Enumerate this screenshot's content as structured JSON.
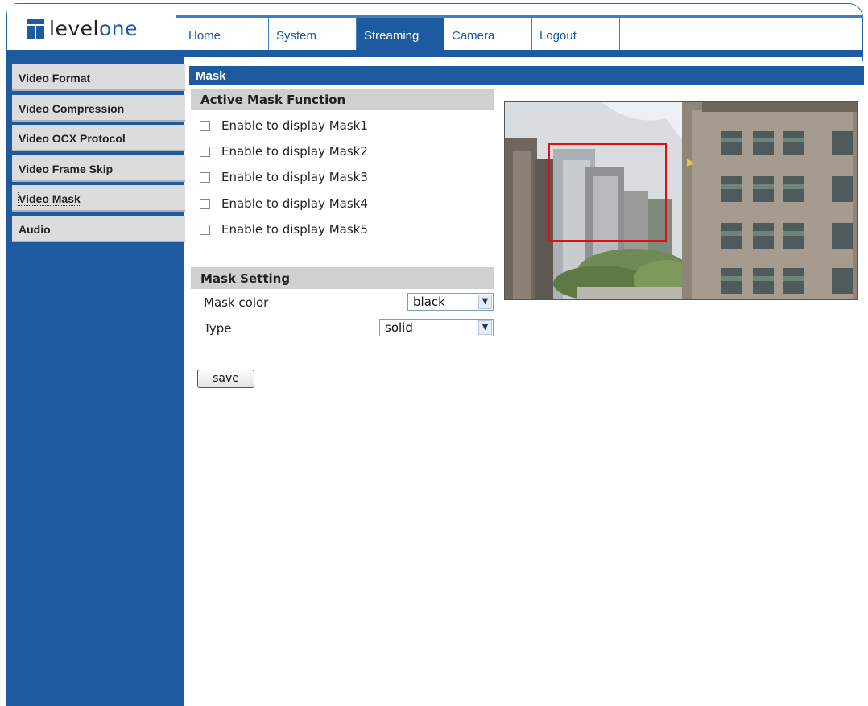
{
  "brand": {
    "logo_text_main": "level",
    "logo_text_accent": "one"
  },
  "tabs": [
    {
      "label": "Home"
    },
    {
      "label": "System"
    },
    {
      "label": "Streaming",
      "active": true
    },
    {
      "label": "Camera"
    },
    {
      "label": "Logout"
    }
  ],
  "sidebar": {
    "items": [
      {
        "label": "Video Format"
      },
      {
        "label": "Video Compression"
      },
      {
        "label": "Video OCX Protocol"
      },
      {
        "label": "Video Frame Skip"
      },
      {
        "label": "Video Mask",
        "active": true
      },
      {
        "label": "Audio"
      }
    ]
  },
  "page": {
    "title": "Mask"
  },
  "active_mask": {
    "heading": "Active Mask Function",
    "options": [
      {
        "label": "Enable to display Mask1",
        "checked": false
      },
      {
        "label": "Enable to display Mask2",
        "checked": false
      },
      {
        "label": "Enable to display Mask3",
        "checked": false
      },
      {
        "label": "Enable to display Mask4",
        "checked": false
      },
      {
        "label": "Enable to display Mask5",
        "checked": false
      }
    ]
  },
  "mask_setting": {
    "heading": "Mask Setting",
    "color_label": "Mask color",
    "color_value": "black",
    "type_label": "Type",
    "type_value": "solid"
  },
  "actions": {
    "save_label": "save"
  },
  "colors": {
    "brand_blue": "#1e5aa0",
    "section_gray": "#d0d0d0",
    "mask_outline": "#e01010"
  },
  "icons": {
    "dropdown": "chevron-down-icon",
    "checkbox": "checkbox-icon"
  }
}
